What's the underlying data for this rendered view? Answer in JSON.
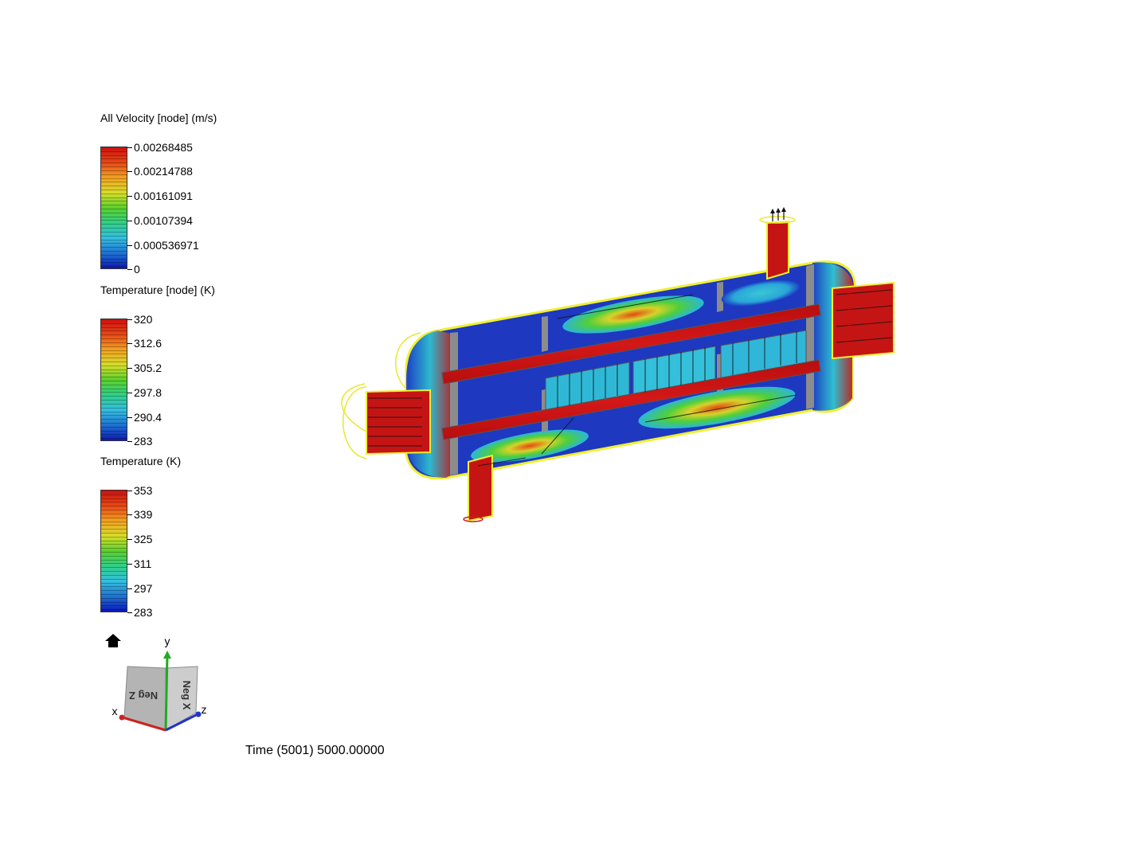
{
  "legends": [
    {
      "title": "All Velocity [node] (m/s)",
      "ticks": [
        "0.00268485",
        "0.00214788",
        "0.00161091",
        "0.00107394",
        "0.000536971",
        "0"
      ]
    },
    {
      "title": "Temperature [node] (K)",
      "ticks": [
        "320",
        "312.6",
        "305.2",
        "297.8",
        "290.4",
        "283"
      ]
    },
    {
      "title": "Temperature (K)",
      "ticks": [
        "353",
        "339",
        "325",
        "311",
        "297",
        "283"
      ]
    }
  ],
  "colormap": [
    "#0b18b8",
    "#1e6fd0",
    "#34bfe0",
    "#2fcf8a",
    "#5ad02c",
    "#d6de2a",
    "#f2a020",
    "#e84a16",
    "#cc1010"
  ],
  "view_cube": {
    "front_face": "Neg Z",
    "side_face": "Neg X",
    "axis_x": "x",
    "axis_y": "y",
    "axis_z": "z"
  },
  "icons": {
    "home": "home-icon"
  },
  "time_text": "Time (5001) 5000.00000"
}
